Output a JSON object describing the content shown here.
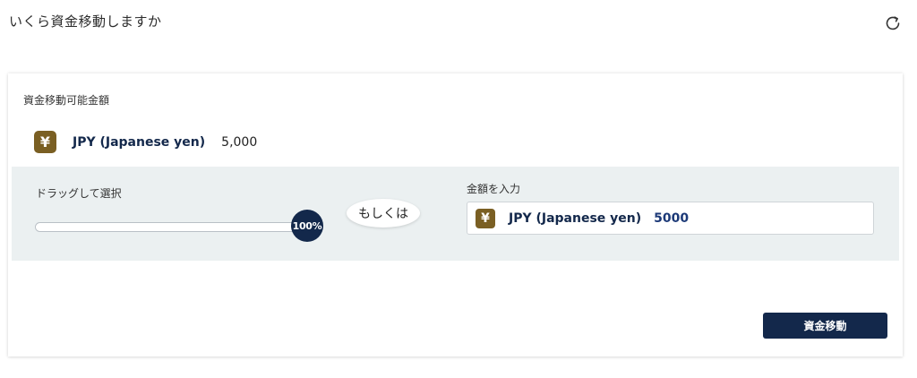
{
  "header": {
    "title": "いくら資金移動しますか",
    "refresh_icon": "refresh-icon"
  },
  "available": {
    "label": "資金移動可能金額",
    "currency_symbol": "¥",
    "currency_name": "JPY (Japanese yen)",
    "amount": "5,000"
  },
  "slider": {
    "label": "ドラッグして選択",
    "value_text": "100%",
    "value_fraction": 1.0
  },
  "separator": {
    "text": "もしくは"
  },
  "amount_input": {
    "label": "金額を入力",
    "currency_symbol": "¥",
    "currency_name": "JPY (Japanese yen)",
    "value": "5000"
  },
  "actions": {
    "transfer_label": "資金移動"
  },
  "colors": {
    "primary": "#13284b",
    "panel_bg": "#ebf0f1",
    "yen_icon_bg": "#7a5f23",
    "amount_value": "#1d3a78"
  }
}
